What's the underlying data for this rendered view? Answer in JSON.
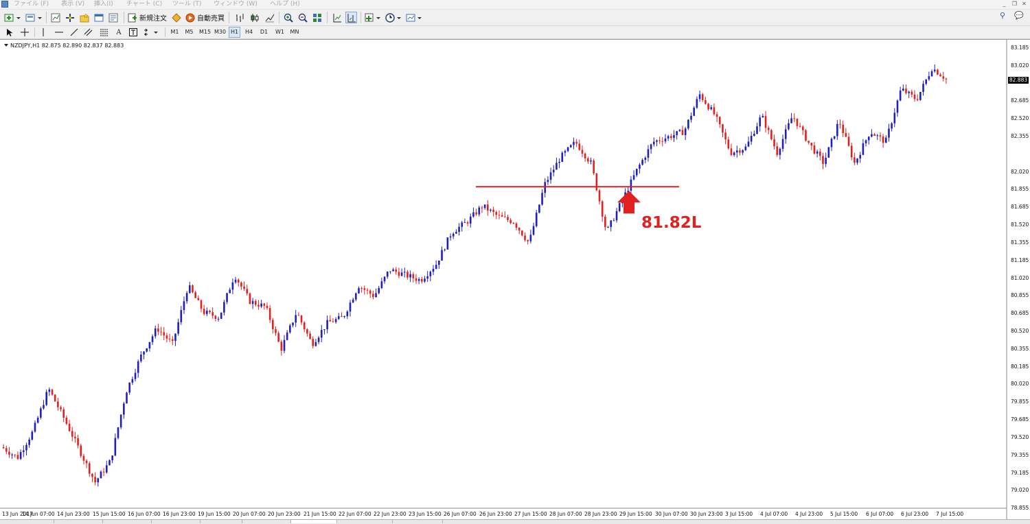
{
  "menu": {
    "items": [
      "ファイル (F)",
      "表示 (V)",
      "挿入(I)",
      "チャート (C)",
      "ツール (T)",
      "ウィンドウ (W)",
      "ヘルプ (H)"
    ]
  },
  "toolbar": {
    "new_order_label": "新規注文",
    "auto_trade_label": "自動売買"
  },
  "timeframes": [
    "M1",
    "M5",
    "M15",
    "M30",
    "H1",
    "H4",
    "D1",
    "W1",
    "MN"
  ],
  "chart_header": {
    "info": "NZDJPY,H1  82.875 82.890 82.837 82.883"
  },
  "price_axis": {
    "ticks": [
      "83.185",
      "83.020",
      "82.685",
      "82.520",
      "82.355",
      "82.020",
      "81.855",
      "81.685",
      "81.520",
      "81.355",
      "81.185",
      "81.020",
      "80.855",
      "80.685",
      "80.520",
      "80.355",
      "80.185",
      "80.020",
      "79.855",
      "79.685",
      "79.520",
      "79.355",
      "79.185",
      "79.020",
      "78.855"
    ],
    "current_price": "82.883"
  },
  "time_axis": {
    "ticks": [
      "13 Jun 2017",
      "14 Jun 07:00",
      "14 Jun 23:00",
      "15 Jun 15:00",
      "16 Jun 07:00",
      "16 Jun 23:00",
      "19 Jun 15:00",
      "20 Jun 07:00",
      "20 Jun 23:00",
      "21 Jun 15:00",
      "22 Jun 07:00",
      "22 Jun 23:00",
      "23 Jun 15:00",
      "26 Jun 07:00",
      "26 Jun 23:00",
      "27 Jun 15:00",
      "28 Jun 07:00",
      "28 Jun 23:00",
      "29 Jun 15:00",
      "30 Jun 07:00",
      "30 Jun 23:00",
      "3 Jul 15:00",
      "4 Jul 07:00",
      "4 Jul 23:00",
      "5 Jul 15:00",
      "6 Jul 07:00",
      "6 Jul 23:00",
      "7 Jul 15:00"
    ]
  },
  "annotation": {
    "text": "81.82L",
    "level_price": 81.88,
    "color": "#e0211f"
  },
  "colors": {
    "bull": "#1f1fc0",
    "bear": "#e0211f",
    "background": "#ffffff",
    "accent": "#2c5b9a"
  },
  "chart_data": {
    "type": "candlestick",
    "symbol": "NZDJPY",
    "timeframe": "H1",
    "ohlc_header": {
      "open": 82.875,
      "high": 82.89,
      "low": 82.837,
      "close": 82.883
    },
    "ylim": [
      78.855,
      83.185
    ],
    "price_path": [
      {
        "x": "13 Jun 2017",
        "price": 79.43
      },
      {
        "x": "13 Jun 2017 +",
        "price": 79.33
      },
      {
        "x": "13 Jun late",
        "price": 79.58
      },
      {
        "x": "14 Jun 07:00",
        "price": 79.98
      },
      {
        "x": "14 Jun 15:00",
        "price": 79.7
      },
      {
        "x": "14 Jun 19:00",
        "price": 79.4
      },
      {
        "x": "14 Jun 23:00",
        "price": 79.1
      },
      {
        "x": "15 Jun 03:00",
        "price": 79.3
      },
      {
        "x": "15 Jun 15:00",
        "price": 79.95
      },
      {
        "x": "16 Jun 07:00",
        "price": 80.3
      },
      {
        "x": "16 Jun 11:00",
        "price": 80.55
      },
      {
        "x": "16 Jun 19:00",
        "price": 80.4
      },
      {
        "x": "16 Jun 23:00",
        "price": 80.95
      },
      {
        "x": "19 Jun 07:00",
        "price": 80.7
      },
      {
        "x": "19 Jun 15:00",
        "price": 80.65
      },
      {
        "x": "20 Jun 03:00",
        "price": 81.05
      },
      {
        "x": "20 Jun 07:00",
        "price": 80.8
      },
      {
        "x": "20 Jun 15:00",
        "price": 80.75
      },
      {
        "x": "20 Jun 23:00",
        "price": 80.35
      },
      {
        "x": "21 Jun 07:00",
        "price": 80.7
      },
      {
        "x": "21 Jun 15:00",
        "price": 80.4
      },
      {
        "x": "21 Jun 19:00",
        "price": 80.6
      },
      {
        "x": "22 Jun 07:00",
        "price": 80.65
      },
      {
        "x": "22 Jun 15:00",
        "price": 80.95
      },
      {
        "x": "22 Jun 23:00",
        "price": 80.85
      },
      {
        "x": "23 Jun 07:00",
        "price": 81.1
      },
      {
        "x": "23 Jun 15:00",
        "price": 81.05
      },
      {
        "x": "23 Jun 19:00",
        "price": 81.0
      },
      {
        "x": "26 Jun 03:00",
        "price": 81.15
      },
      {
        "x": "26 Jun 07:00",
        "price": 81.45
      },
      {
        "x": "26 Jun 15:00",
        "price": 81.55
      },
      {
        "x": "26 Jun 23:00",
        "price": 81.7
      },
      {
        "x": "27 Jun 07:00",
        "price": 81.6
      },
      {
        "x": "27 Jun 15:00",
        "price": 81.55
      },
      {
        "x": "28 Jun 03:00",
        "price": 81.35
      },
      {
        "x": "28 Jun 07:00",
        "price": 81.9
      },
      {
        "x": "28 Jun 15:00",
        "price": 82.15
      },
      {
        "x": "28 Jun 23:00",
        "price": 82.3
      },
      {
        "x": "29 Jun 07:00",
        "price": 82.1
      },
      {
        "x": "29 Jun 11:00",
        "price": 81.45
      },
      {
        "x": "29 Jun 15:00",
        "price": 81.75
      },
      {
        "x": "30 Jun 03:00",
        "price": 82.05
      },
      {
        "x": "30 Jun 07:00",
        "price": 82.3
      },
      {
        "x": "30 Jun 23:00",
        "price": 82.35
      },
      {
        "x": "3 Jul 07:00",
        "price": 82.4
      },
      {
        "x": "3 Jul 11:00",
        "price": 82.75
      },
      {
        "x": "3 Jul 15:00",
        "price": 82.55
      },
      {
        "x": "4 Jul 03:00",
        "price": 82.2
      },
      {
        "x": "4 Jul 07:00",
        "price": 82.25
      },
      {
        "x": "4 Jul 11:00",
        "price": 82.55
      },
      {
        "x": "4 Jul 23:00",
        "price": 82.2
      },
      {
        "x": "5 Jul 07:00",
        "price": 82.55
      },
      {
        "x": "5 Jul 15:00",
        "price": 82.3
      },
      {
        "x": "5 Jul 23:00",
        "price": 82.1
      },
      {
        "x": "6 Jul 03:00",
        "price": 82.5
      },
      {
        "x": "6 Jul 07:00",
        "price": 82.1
      },
      {
        "x": "6 Jul 15:00",
        "price": 82.4
      },
      {
        "x": "6 Jul 23:00",
        "price": 82.3
      },
      {
        "x": "7 Jul 07:00",
        "price": 82.8
      },
      {
        "x": "7 Jul 15:00",
        "price": 82.7
      },
      {
        "x": "7 Jul 19:00",
        "price": 83.0
      },
      {
        "x": "7 Jul 23:00",
        "price": 82.883
      }
    ],
    "horizontal_line": {
      "price": 81.88,
      "from": "26 Jun 07:00",
      "to": "30 Jun 07:00"
    },
    "arrow": {
      "direction": "up",
      "at": "29 Jun 15:00",
      "price": 81.75
    }
  }
}
